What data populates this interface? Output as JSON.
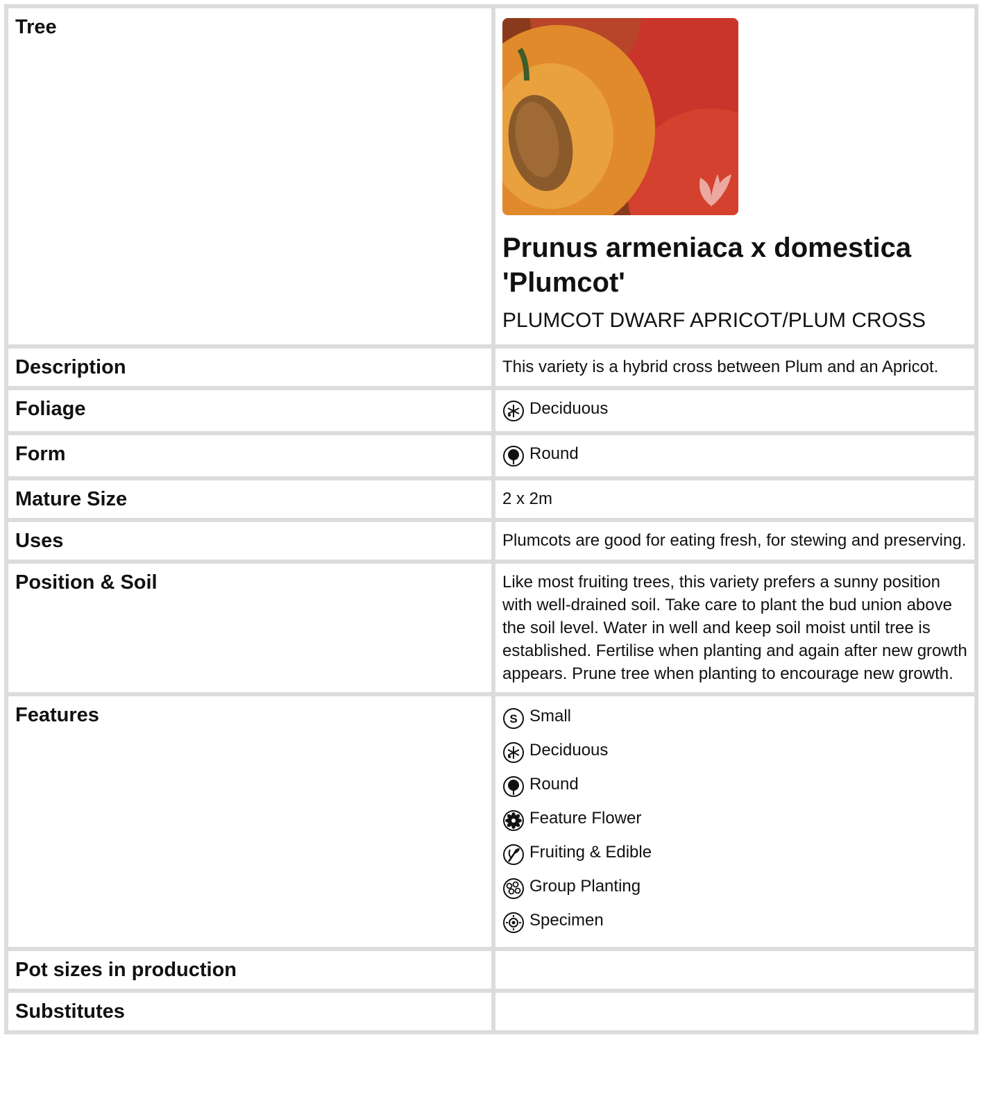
{
  "rows": {
    "tree": {
      "label": "Tree",
      "scientific_name": "Prunus armeniaca x domestica 'Plumcot'",
      "common_name": "PLUMCOT DWARF APRICOT/PLUM CROSS"
    },
    "description": {
      "label": "Description",
      "value": "This variety is a hybrid cross between Plum and an Apricot."
    },
    "foliage": {
      "label": "Foliage",
      "value": "Deciduous",
      "icon": "deciduous-icon"
    },
    "form": {
      "label": "Form",
      "value": "Round",
      "icon": "round-form-icon"
    },
    "mature_size": {
      "label": "Mature Size",
      "value": "2 x 2m"
    },
    "uses": {
      "label": "Uses",
      "value": "Plumcots are good for eating fresh, for stewing and preserving."
    },
    "position_soil": {
      "label": "Position & Soil",
      "value": "Like most fruiting trees, this variety prefers a sunny position with well-drained soil. Take care to plant the bud union above the soil level. Water in well and keep soil moist until tree is established. Fertilise when planting and again after new growth appears. Prune tree when planting to encourage new growth."
    },
    "features": {
      "label": "Features",
      "items": [
        {
          "label": "Small",
          "icon": "small-icon"
        },
        {
          "label": "Deciduous",
          "icon": "deciduous-icon"
        },
        {
          "label": "Round",
          "icon": "round-form-icon"
        },
        {
          "label": "Feature Flower",
          "icon": "flower-icon"
        },
        {
          "label": "Fruiting & Edible",
          "icon": "fork-icon"
        },
        {
          "label": "Group Planting",
          "icon": "group-planting-icon"
        },
        {
          "label": "Specimen",
          "icon": "specimen-icon"
        }
      ]
    },
    "pot_sizes": {
      "label": "Pot sizes in production",
      "value": ""
    },
    "substitutes": {
      "label": "Substitutes",
      "value": ""
    }
  },
  "colors": {
    "border": "#dcdcdc",
    "text": "#111111",
    "fruit_red": "#c9352a",
    "fruit_orange": "#e08a2c"
  }
}
